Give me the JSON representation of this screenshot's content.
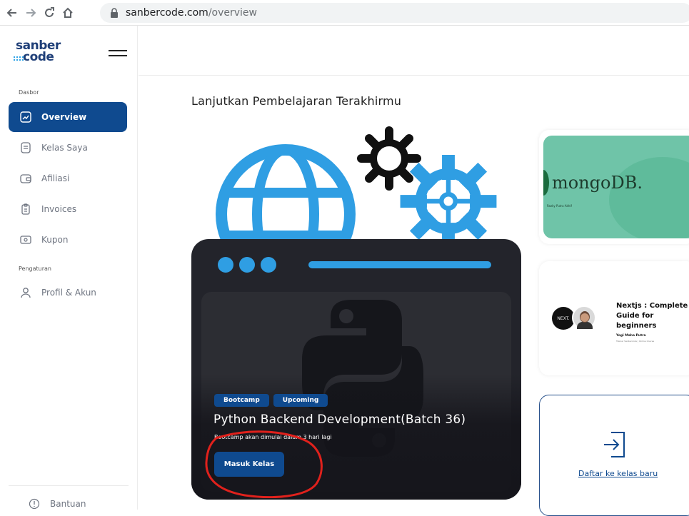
{
  "browser": {
    "url_host": "sanbercode.com",
    "url_path": "/overview"
  },
  "sidebar": {
    "logo_line1": "sanber",
    "logo_line2": "code",
    "section_main": "Dasbor",
    "items": [
      {
        "label": "Overview",
        "icon": "chart-trend-icon",
        "active": true
      },
      {
        "label": "Kelas Saya",
        "icon": "document-icon",
        "active": false
      },
      {
        "label": "Afiliasi",
        "icon": "wallet-icon",
        "active": false
      },
      {
        "label": "Invoices",
        "icon": "clipboard-icon",
        "active": false
      },
      {
        "label": "Kupon",
        "icon": "coupon-icon",
        "active": false
      }
    ],
    "section_settings": "Pengaturan",
    "settings_items": [
      {
        "label": "Profil & Akun",
        "icon": "user-icon"
      }
    ],
    "help_label": "Bantuan"
  },
  "main": {
    "title": "Lanjutkan Pembelajaran Terakhirmu",
    "hero": {
      "tags": [
        "Bootcamp",
        "Upcoming"
      ],
      "course_title": "Python Backend Development(Batch 36)",
      "course_subtitle": "Bootcamp akan dimulai dalam 3 hari lagi",
      "button_label": "Masuk Kelas"
    },
    "cards": {
      "mongo": {
        "brand": "mongoDB.",
        "author": "Rezky Putra Akhif"
      },
      "next": {
        "logo": "NEXT.",
        "title": "Nextjs : Complete Guide for beginners",
        "author": "Yogi Maha Putra",
        "author_role": "Trainer Sanbercode | Online Course"
      },
      "new_class_link": "Daftar ke kelas baru"
    }
  },
  "colors": {
    "primary": "#0f4a8f",
    "accent_blue": "#2fa3e6",
    "mongo_green": "#6fc4a8",
    "annotation_red": "#e0211c"
  }
}
